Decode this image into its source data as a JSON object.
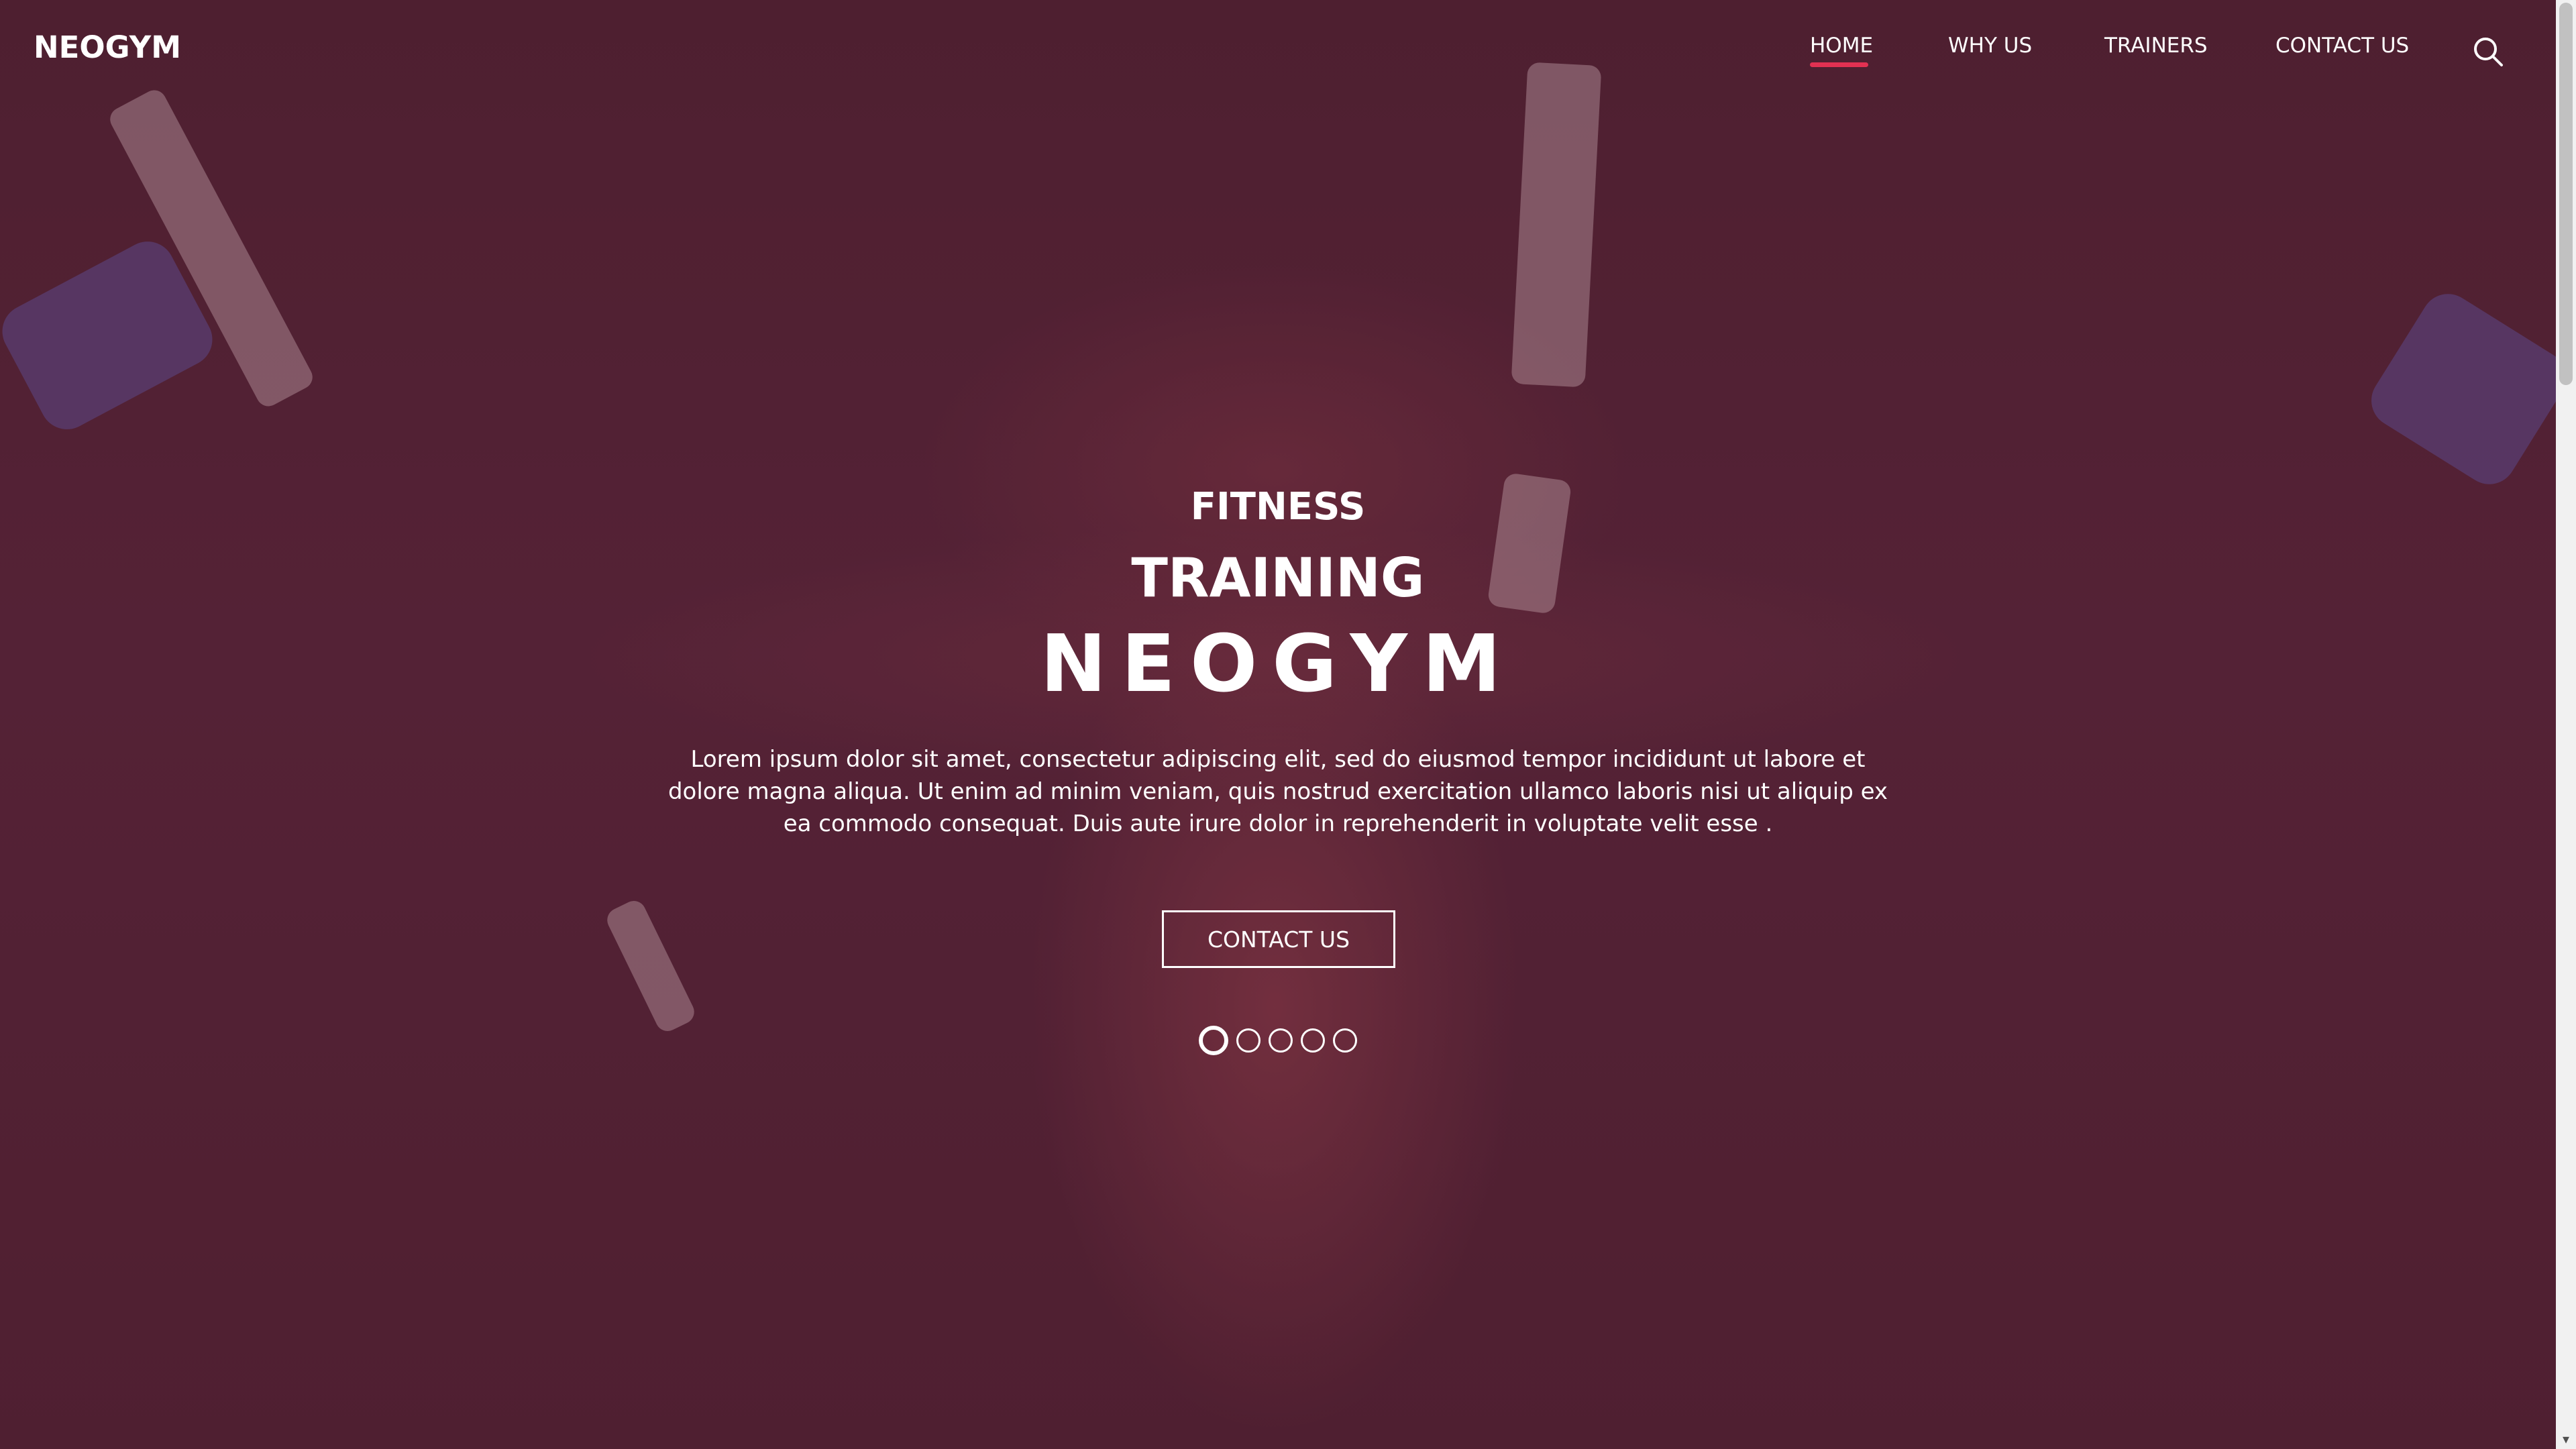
{
  "brand": "NEOGYM",
  "nav": {
    "items": [
      {
        "label": "HOME",
        "active": true
      },
      {
        "label": "WHY US",
        "active": false
      },
      {
        "label": "TRAINERS",
        "active": false
      },
      {
        "label": "CONTACT US",
        "active": false
      }
    ],
    "search_icon": "search-icon"
  },
  "hero": {
    "subtitle_1": "FITNESS",
    "subtitle_2": "TRAINING",
    "title": "NEOGYM",
    "description": "Lorem ipsum dolor sit amet, consectetur adipiscing elit, sed do eiusmod tempor incididunt ut labore et dolore magna aliqua. Ut enim ad minim veniam, quis nostrud exercitation ullamco laboris nisi ut aliquip ex ea commodo consequat. Duis aute irure dolor in reprehenderit in voluptate velit esse .",
    "cta_label": "CONTACT US"
  },
  "carousel": {
    "slide_count": 5,
    "active_index": 0
  },
  "colors": {
    "accent": "#e23152",
    "overlay": "#54182c",
    "text": "#ffffff"
  }
}
